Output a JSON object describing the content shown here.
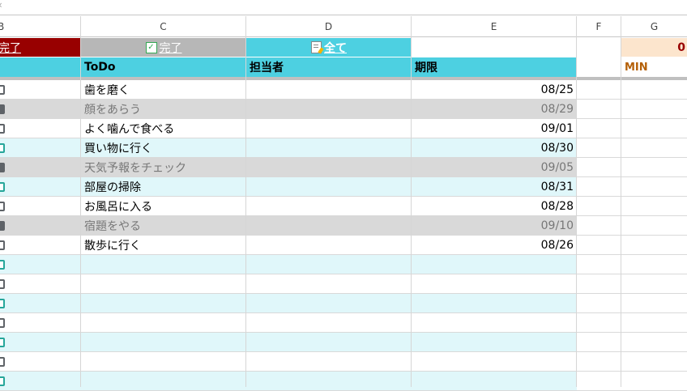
{
  "columns": {
    "b": "B",
    "c": "C",
    "d": "D",
    "e": "E",
    "f": "F",
    "g": "G"
  },
  "buttons": {
    "incomplete": "完了",
    "complete": "完了",
    "all": "全て"
  },
  "icons": {
    "complete_icon": "checkbox-icon",
    "all_icon": "memo-icon"
  },
  "counter": {
    "value": "0"
  },
  "headers": {
    "todo": "ToDo",
    "assignee": "担当者",
    "due": "期限",
    "min": "MIN"
  },
  "colors": {
    "red": "#980000",
    "gray": "#b7b7b7",
    "cyan": "#4dd0e1",
    "light_cyan": "#e0f7fa",
    "done": "#d9d9d9",
    "orange_cell": "#fce5cd",
    "min_text": "#b45f06"
  },
  "rows": [
    {
      "todo": "歯を磨く",
      "due": "08/25",
      "done": false
    },
    {
      "todo": "顔をあらう",
      "due": "08/29",
      "done": true
    },
    {
      "todo": "よく噛んで食べる",
      "due": "09/01",
      "done": false
    },
    {
      "todo": "買い物に行く",
      "due": "08/30",
      "done": false
    },
    {
      "todo": "天気予報をチェック",
      "due": "09/05",
      "done": true
    },
    {
      "todo": "部屋の掃除",
      "due": "08/31",
      "done": false
    },
    {
      "todo": "お風呂に入る",
      "due": "08/28",
      "done": false
    },
    {
      "todo": "宿題をやる",
      "due": "09/10",
      "done": true
    },
    {
      "todo": "散歩に行く",
      "due": "08/26",
      "done": false
    },
    {
      "todo": "",
      "due": "",
      "done": false
    },
    {
      "todo": "",
      "due": "",
      "done": false
    },
    {
      "todo": "",
      "due": "",
      "done": false
    },
    {
      "todo": "",
      "due": "",
      "done": false
    },
    {
      "todo": "",
      "due": "",
      "done": false
    },
    {
      "todo": "",
      "due": "",
      "done": false
    },
    {
      "todo": "",
      "due": "",
      "done": false
    }
  ]
}
